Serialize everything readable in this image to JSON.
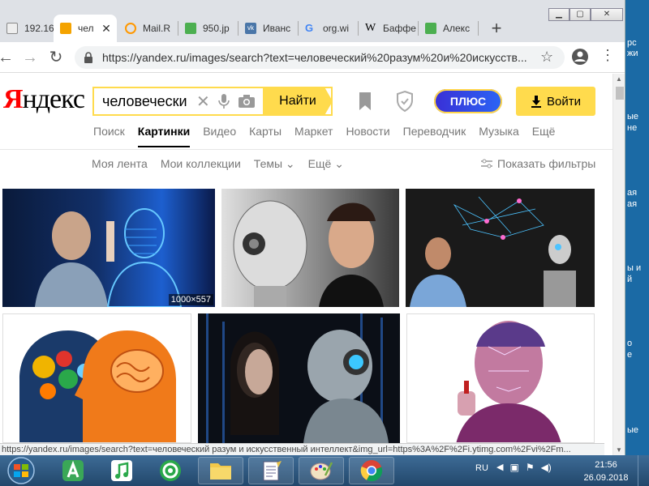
{
  "browser": {
    "tabs": [
      {
        "title": "192.16",
        "color": "#9e9e9e"
      },
      {
        "title": "чел",
        "color": "#f4a300",
        "active": true
      },
      {
        "title": "Mail.R",
        "color": "#ff9800"
      },
      {
        "title": "950.jp",
        "color": "#4caf50"
      },
      {
        "title": "Иванс",
        "color": "#4a76a8"
      },
      {
        "title": "org.wi",
        "color": "#4285f4"
      },
      {
        "title": "Бaффе",
        "color": "#333333"
      },
      {
        "title": "Алекс",
        "color": "#4caf50"
      }
    ],
    "new_tab_icon": "+",
    "url": "https://yandex.ru/images/search?text=человеческий%20разум%20и%20искусств..."
  },
  "yandex": {
    "logo_red": "Я",
    "logo_rest": "ндекс",
    "search_value": "человечески",
    "search_button": "Найти",
    "plus_label": "ПЛЮС",
    "login_label": "Войти",
    "services": [
      "Поиск",
      "Картинки",
      "Видео",
      "Карты",
      "Маркет",
      "Новости",
      "Переводчик",
      "Музыка",
      "Ещё"
    ],
    "active_service": "Картинки",
    "subnav": [
      "Моя лента",
      "Мои коллекции",
      "Темы ⌄",
      "Ещё ⌄"
    ],
    "filters_label": "Показать фильтры"
  },
  "results": {
    "first_size": "1000×557"
  },
  "status_url": "https://yandex.ru/images/search?text=человеческий разум и искусственный интеллект&img_url=https%3A%2F%2Fi.ytimg.com%2Fvi%2Fm...",
  "desktop_right_text": [
    "рс",
    "жи",
    "ые",
    "не",
    "ая",
    "ая",
    "ы и",
    "й",
    "о",
    "е",
    "ые"
  ],
  "taskbar": {
    "lang": "RU",
    "time": "21:56",
    "date": "26.09.2018"
  },
  "colors": {
    "yandex_yellow": "#ffdb4d",
    "yandex_red": "#ff0000",
    "taskbar": "#2c5a85"
  }
}
